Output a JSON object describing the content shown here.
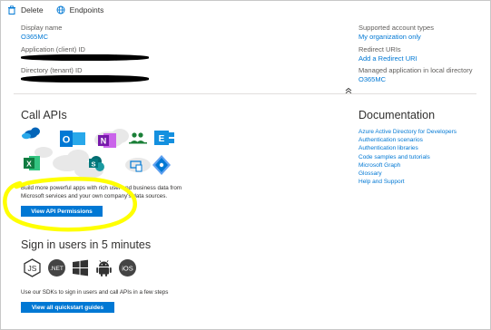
{
  "toolbar": {
    "delete_label": "Delete",
    "endpoints_label": "Endpoints"
  },
  "essentials": {
    "display_name_label": "Display name",
    "display_name_value": "O365MC",
    "app_id_label": "Application (client) ID",
    "tenant_id_label": "Directory (tenant) ID",
    "account_types_label": "Supported account types",
    "account_types_value": "My organization only",
    "redirect_label": "Redirect URIs",
    "redirect_value": "Add a Redirect URI",
    "managed_label": "Managed application in local directory",
    "managed_value": "O365MC"
  },
  "call_apis": {
    "title": "Call APIs",
    "description_line1": "Build more powerful apps with rich user and business data from",
    "description_line2": "Microsoft services and your own company's data sources.",
    "button_label": "View API Permissions",
    "app_icons": [
      "onedrive-icon",
      "outlook-icon",
      "onenote-icon",
      "teams-icon",
      "exchange-icon",
      "excel-icon",
      "sharepoint-icon",
      "intune-icon",
      "cloud-icon"
    ]
  },
  "documentation": {
    "title": "Documentation",
    "links": [
      "Azure Active Directory for Developers",
      "Authentication scenarios",
      "Authentication libraries",
      "Code samples and tutorials",
      "Microsoft Graph",
      "Glossary",
      "Help and Support"
    ]
  },
  "sign_in": {
    "title": "Sign in users in 5 minutes",
    "sdk_icons": [
      "nodejs-icon",
      "dotnet-icon",
      "windows-icon",
      "android-icon",
      "ios-icon"
    ],
    "sdk_labels": [
      "JS",
      ".NET",
      "iOS"
    ],
    "description": "Use our SDKs to sign in users and call APIs in a few steps",
    "button_label": "View all quickstart guides"
  },
  "colors": {
    "accent": "#0078d4",
    "highlight": "#ffff00",
    "text": "#323130"
  }
}
